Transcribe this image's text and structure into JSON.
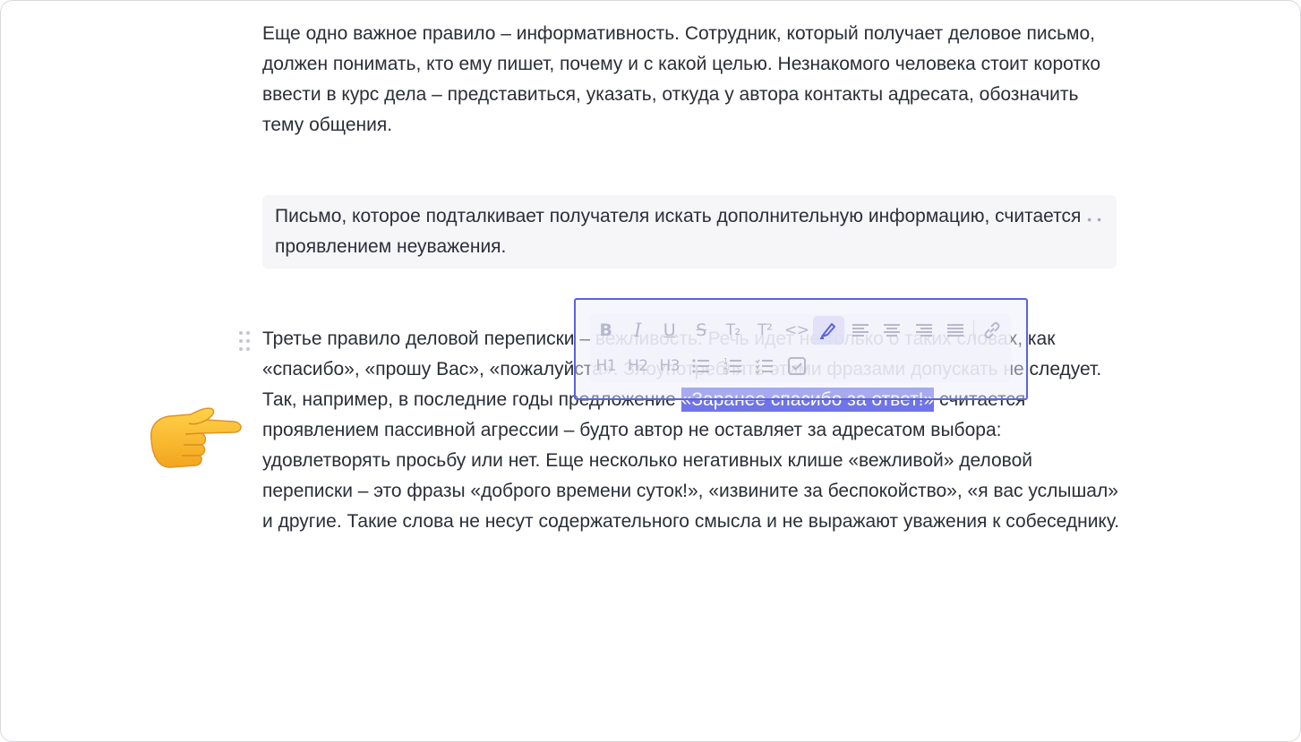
{
  "paragraph1": "Еще одно важное правило – информативность. Сотрудник, который получает деловое письмо, должен понимать, кто ему пишет, почему и с какой целью. Незнакомого человека стоит коротко ввести в курс дела – представиться, указать, откуда у автора контакты адресата, обозначить тему общения.",
  "callout": {
    "text": "Письмо, которое подталкивает получателя искать дополнительную информацию, считается проявлением неуважения."
  },
  "paragraph3": {
    "before_highlight": "Третье правило деловой переписки – вежливость. Речь идет не только о таких словах, как «спасибо», «прошу Вас», «пожалуйста». Злоупотреблять этими фразами допускать не следует. Так, например, в последние годы предложение ",
    "highlighted": "«Заранее спасибо за ответ!»",
    "after_highlight": " считается проявлением пассивной агрессии – будто автор не оставляет за адресатом выбора: удовлетворять просьбу или нет. Еще несколько негативных клише «вежливой» деловой переписки – это фразы «доброго времени суток!», «извините за беспокойство», «я вас услышал» и другие. Такие слова не несут содержательного смысла и не выражают уважения к собеседнику."
  },
  "toolbar": {
    "row1": [
      {
        "name": "bold-button",
        "icon": "bold-icon",
        "glyph": "B"
      },
      {
        "name": "italic-button",
        "icon": "italic-icon",
        "glyph": "I"
      },
      {
        "name": "underline-button",
        "icon": "underline-icon",
        "glyph": "U"
      },
      {
        "name": "strikethrough-button",
        "icon": "strikethrough-icon",
        "glyph": "S"
      },
      {
        "name": "subscript-button",
        "icon": "subscript-icon",
        "glyph": "T₂"
      },
      {
        "name": "superscript-button",
        "icon": "superscript-icon",
        "glyph": "T²"
      },
      {
        "name": "code-button",
        "icon": "code-icon",
        "glyph": "<>"
      },
      {
        "name": "highlight-button",
        "icon": "marker-icon",
        "glyph": "",
        "active": true
      },
      {
        "name": "align-left-button",
        "icon": "align-left-icon",
        "glyph": ""
      },
      {
        "name": "align-center-button",
        "icon": "align-center-icon",
        "glyph": ""
      },
      {
        "name": "align-right-button",
        "icon": "align-right-icon",
        "glyph": ""
      },
      {
        "name": "align-justify-button",
        "icon": "align-justify-icon",
        "glyph": ""
      },
      {
        "name": "link-button",
        "icon": "link-icon",
        "glyph": ""
      }
    ],
    "row2": [
      {
        "name": "heading1-button",
        "icon": "heading1-icon",
        "glyph": "H1"
      },
      {
        "name": "heading2-button",
        "icon": "heading2-icon",
        "glyph": "H2"
      },
      {
        "name": "heading3-button",
        "icon": "heading3-icon",
        "glyph": "H3"
      },
      {
        "name": "bullet-list-button",
        "icon": "bullet-list-icon",
        "glyph": ""
      },
      {
        "name": "numbered-list-button",
        "icon": "numbered-list-icon",
        "glyph": ""
      },
      {
        "name": "checklist-button",
        "icon": "checklist-icon",
        "glyph": ""
      },
      {
        "name": "task-button",
        "icon": "checkbox-icon",
        "glyph": ""
      }
    ]
  },
  "colors": {
    "accent": "#5b61e0",
    "highlight": "#6f74e6",
    "text": "#2b2e38",
    "callout_bg": "#f6f6f9"
  }
}
